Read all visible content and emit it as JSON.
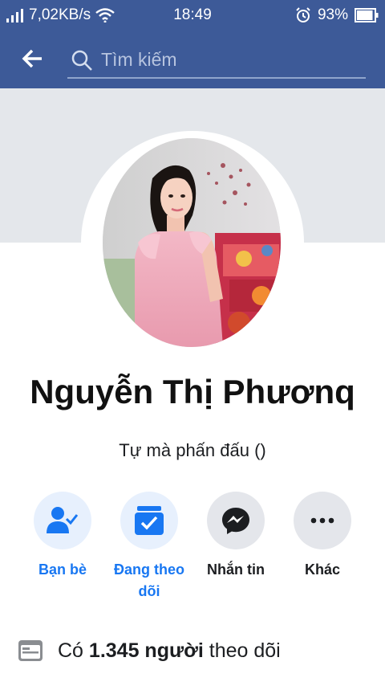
{
  "status": {
    "network_speed": "7,02KB/s",
    "time": "18:49",
    "battery": "93%",
    "battery_level": 0.93
  },
  "search": {
    "placeholder": "Tìm kiếm"
  },
  "profile": {
    "name": "Nguyễn Thị Phươnq",
    "bio": "Tự mà phấn đấu ()"
  },
  "actions": [
    {
      "label": "Bạn bè",
      "icon": "friends-check-icon"
    },
    {
      "label_line1": "Đang theo",
      "label_line2": "dõi",
      "icon": "following-feed-icon"
    },
    {
      "label": "Nhắn tin",
      "icon": "messenger-icon"
    },
    {
      "label": "Khác",
      "icon": "more-dots-icon"
    }
  ],
  "followers": {
    "prefix": "Có",
    "count": "1.345 người",
    "suffix": "theo dõi",
    "icon": "followers-card-icon"
  },
  "colors": {
    "header": "#3d5a98",
    "accent": "#1877f2",
    "action_blue_bg": "#e7f0fd",
    "action_gray_bg": "#e4e6eb"
  }
}
